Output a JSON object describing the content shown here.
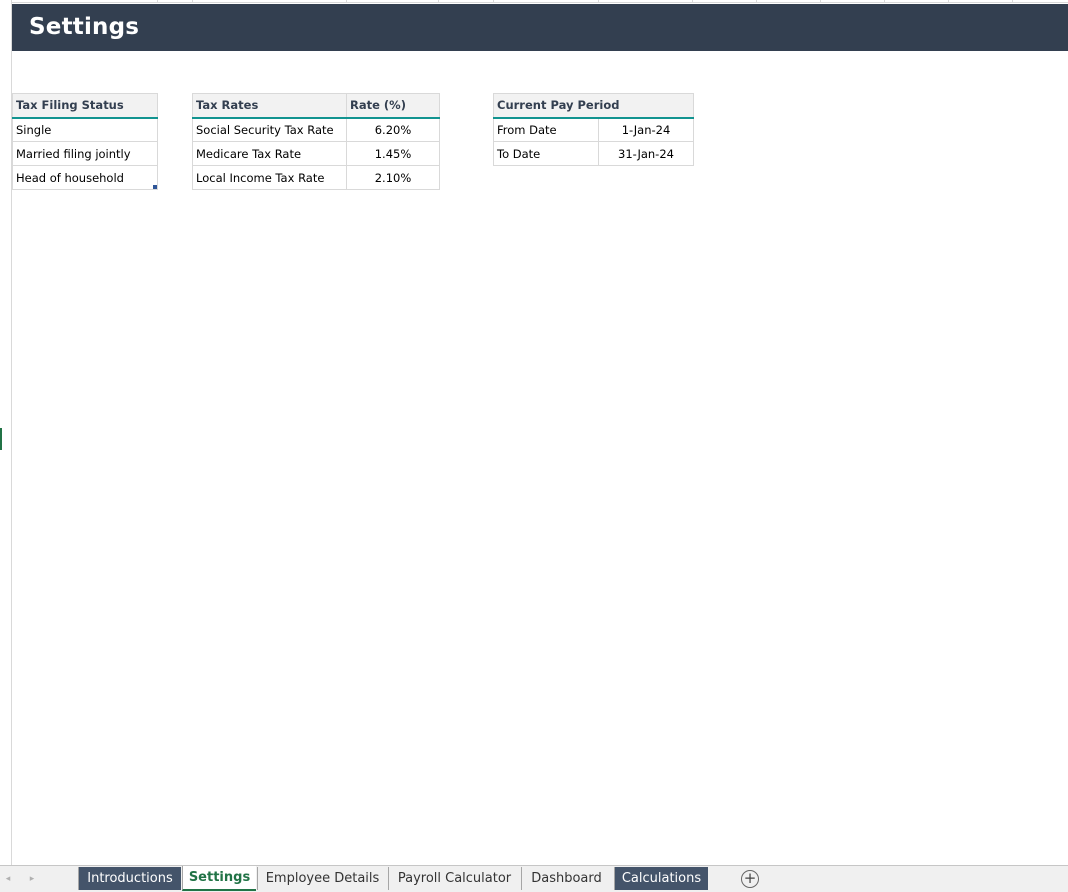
{
  "banner": {
    "title": "Settings"
  },
  "tax_filing_status": {
    "header": "Tax Filing Status",
    "rows": [
      "Single",
      "Married filing jointly",
      "Head of household"
    ]
  },
  "tax_rates": {
    "headers": [
      "Tax Rates",
      "Rate (%)"
    ],
    "rows": [
      [
        "Social Security Tax Rate",
        "6.20%"
      ],
      [
        "Medicare Tax Rate",
        "1.45%"
      ],
      [
        "Local Income Tax Rate",
        "2.10%"
      ]
    ]
  },
  "pay_period": {
    "header": "Current Pay Period",
    "rows": [
      [
        "From Date",
        "1-Jan-24"
      ],
      [
        "To Date",
        "31-Jan-24"
      ]
    ]
  },
  "sheet_tabs": {
    "prev_icon": "◂",
    "next_icon": "▸",
    "tabs": [
      "Introductions",
      "Settings",
      "Employee Details",
      "Payroll Calculator",
      "Dashboard",
      "Calculations"
    ],
    "active": "Settings",
    "add_icon": "+"
  },
  "colors": {
    "banner": "#333f50",
    "header_underline": "#129490",
    "dark_tab": "#44546a",
    "active_tab_text": "#217346"
  }
}
